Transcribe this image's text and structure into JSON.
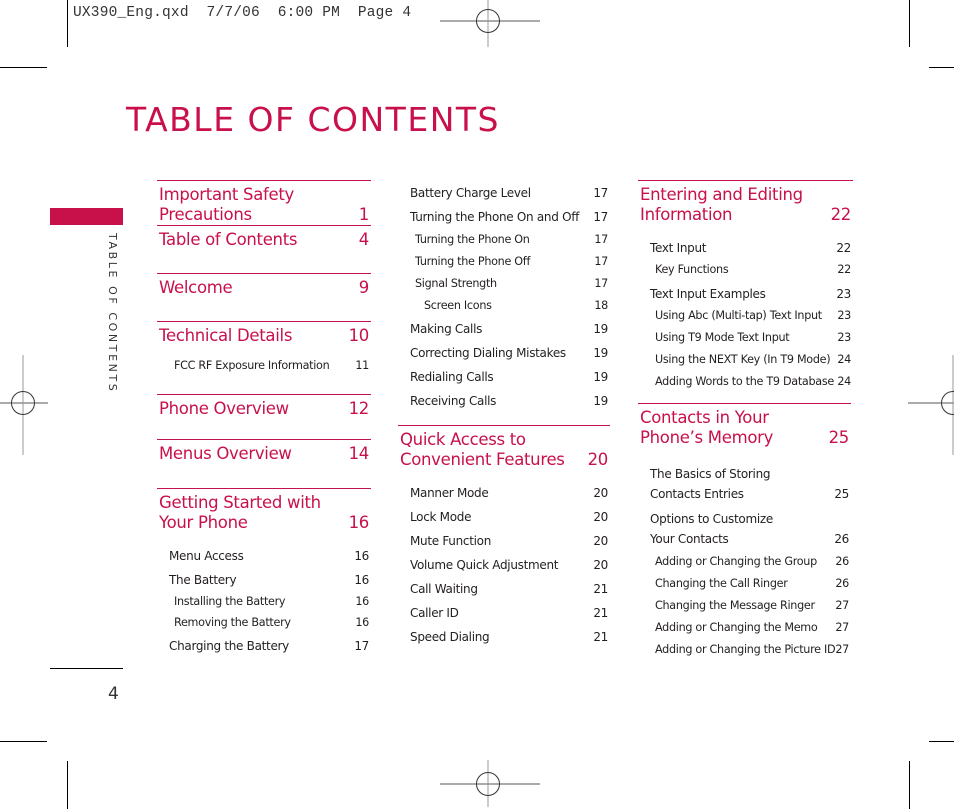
{
  "slug": "UX390_Eng.qxd  7/7/06  6:00 PM  Page 4",
  "title": "TABLE OF CONTENTS",
  "side_tab": "TABLE OF CONTENTS",
  "page_number": "4",
  "accent_color": "#c8104a",
  "col1": [
    {
      "title": "Important Safety Precautions",
      "page": "1",
      "entries": []
    },
    {
      "title": "Table of Contents",
      "page": "4",
      "entries": []
    },
    {
      "title": "Welcome",
      "page": "9",
      "entries": []
    },
    {
      "title": "Technical Details",
      "page": "10",
      "entries": [
        {
          "title": "FCC RF Exposure Information",
          "page": "11",
          "level": 2
        }
      ]
    },
    {
      "title": "Phone Overview",
      "page": "12",
      "entries": []
    },
    {
      "title": "Menus Overview",
      "page": "14",
      "entries": []
    },
    {
      "title": "Getting Started with Your Phone",
      "page": "16",
      "entries": [
        {
          "title": "Menu Access",
          "page": "16",
          "level": 1
        },
        {
          "title": "The Battery",
          "page": "16",
          "level": 1
        },
        {
          "title": "Installing the Battery",
          "page": "16",
          "level": 2
        },
        {
          "title": "Removing the Battery",
          "page": "16",
          "level": 2
        },
        {
          "title": "Charging the Battery",
          "page": "17",
          "level": 1
        }
      ]
    }
  ],
  "col2_top": [
    {
      "title": "Battery Charge Level",
      "page": "17",
      "level": 1
    },
    {
      "title": "Turning the Phone On and Off",
      "page": "17",
      "level": 1
    },
    {
      "title": "Turning the Phone On",
      "page": "17",
      "level": 2
    },
    {
      "title": "Turning the Phone Off",
      "page": "17",
      "level": 2
    },
    {
      "title": "Signal Strength",
      "page": "17",
      "level": 2
    },
    {
      "title": "Screen Icons",
      "page": "18",
      "level": 3
    },
    {
      "title": "Making Calls",
      "page": "19",
      "level": 1
    },
    {
      "title": "Correcting Dialing Mistakes",
      "page": "19",
      "level": 1
    },
    {
      "title": "Redialing Calls",
      "page": "19",
      "level": 1
    },
    {
      "title": "Receiving Calls",
      "page": "19",
      "level": 1
    }
  ],
  "col2": [
    {
      "title": "Quick Access to Convenient Features",
      "page": "20",
      "entries": [
        {
          "title": "Manner Mode",
          "page": "20",
          "level": 1
        },
        {
          "title": "Lock Mode",
          "page": "20",
          "level": 1
        },
        {
          "title": "Mute Function",
          "page": "20",
          "level": 1
        },
        {
          "title": "Volume Quick Adjustment",
          "page": "20",
          "level": 1
        },
        {
          "title": "Call Waiting",
          "page": "21",
          "level": 1
        },
        {
          "title": "Caller ID",
          "page": "21",
          "level": 1
        },
        {
          "title": "Speed Dialing",
          "page": "21",
          "level": 1
        }
      ]
    }
  ],
  "col3": [
    {
      "title": "Entering and Editing Information",
      "page": "22",
      "entries": [
        {
          "title": "Text Input",
          "page": "22",
          "level": 1
        },
        {
          "title": "Key Functions",
          "page": "22",
          "level": 2
        },
        {
          "title": "Text Input Examples",
          "page": "23",
          "level": 1
        },
        {
          "title": "Using Abc (Multi-tap) Text Input",
          "page": "23",
          "level": 2
        },
        {
          "title": "Using T9 Mode Text Input",
          "page": "23",
          "level": 2
        },
        {
          "title": "Using the NEXT Key (In T9 Mode)",
          "page": "24",
          "level": 2
        },
        {
          "title": "Adding Words to the T9 Database",
          "page": "24",
          "level": 2
        }
      ]
    },
    {
      "title": "Contacts in Your Phone’s Memory",
      "page": "25",
      "entries": [
        {
          "title": "The Basics of Storing Contacts Entries",
          "page": "25",
          "level": 1
        },
        {
          "title": "Options to Customize Your Contacts",
          "page": "26",
          "level": 1
        },
        {
          "title": "Adding or Changing the Group",
          "page": "26",
          "level": 2
        },
        {
          "title": "Changing the Call Ringer",
          "page": "26",
          "level": 2
        },
        {
          "title": "Changing the Message Ringer",
          "page": "27",
          "level": 2
        },
        {
          "title": "Adding or Changing the Memo",
          "page": "27",
          "level": 2
        },
        {
          "title": "Adding or Changing the Picture ID",
          "page": "27",
          "level": 2
        }
      ]
    }
  ]
}
